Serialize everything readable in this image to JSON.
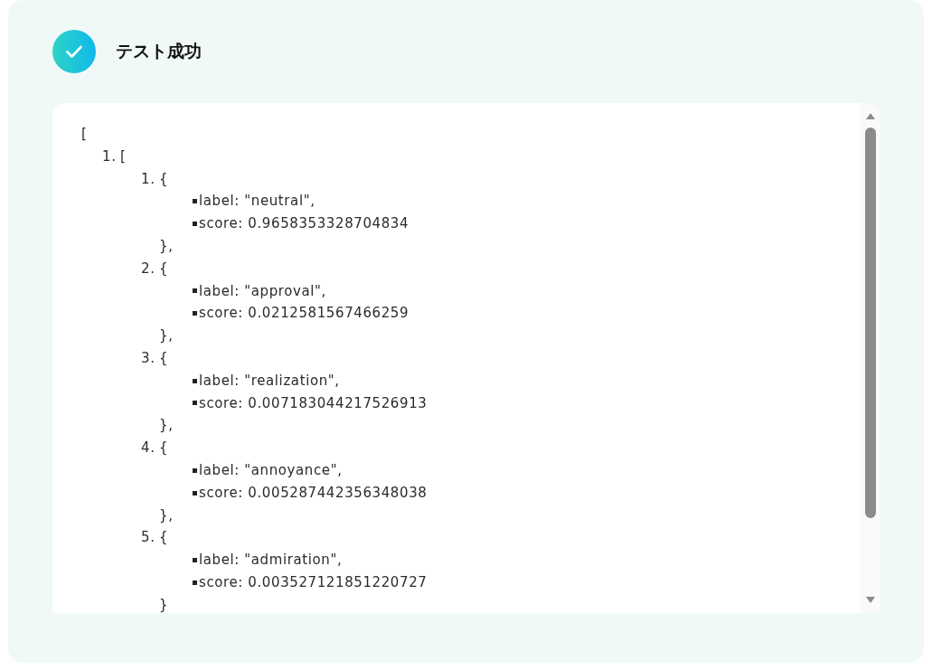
{
  "header": {
    "success": true,
    "title": "テスト成功"
  },
  "output": {
    "open": "[",
    "items": [
      {
        "number": "1.",
        "open": "[",
        "children": [
          {
            "number": "1.",
            "open": "{",
            "fields": [
              "label: \"neutral\",",
              "score: 0.9658353328704834"
            ],
            "close": "},"
          },
          {
            "number": "2.",
            "open": "{",
            "fields": [
              "label: \"approval\",",
              "score: 0.0212581567466259"
            ],
            "close": "},"
          },
          {
            "number": "3.",
            "open": "{",
            "fields": [
              "label: \"realization\",",
              "score: 0.007183044217526913"
            ],
            "close": "},"
          },
          {
            "number": "4.",
            "open": "{",
            "fields": [
              "label: \"annoyance\",",
              "score: 0.005287442356348038"
            ],
            "close": "},"
          },
          {
            "number": "5.",
            "open": "{",
            "fields": [
              "label: \"admiration\",",
              "score: 0.003527121851220727"
            ],
            "close": "}"
          }
        ]
      }
    ]
  }
}
